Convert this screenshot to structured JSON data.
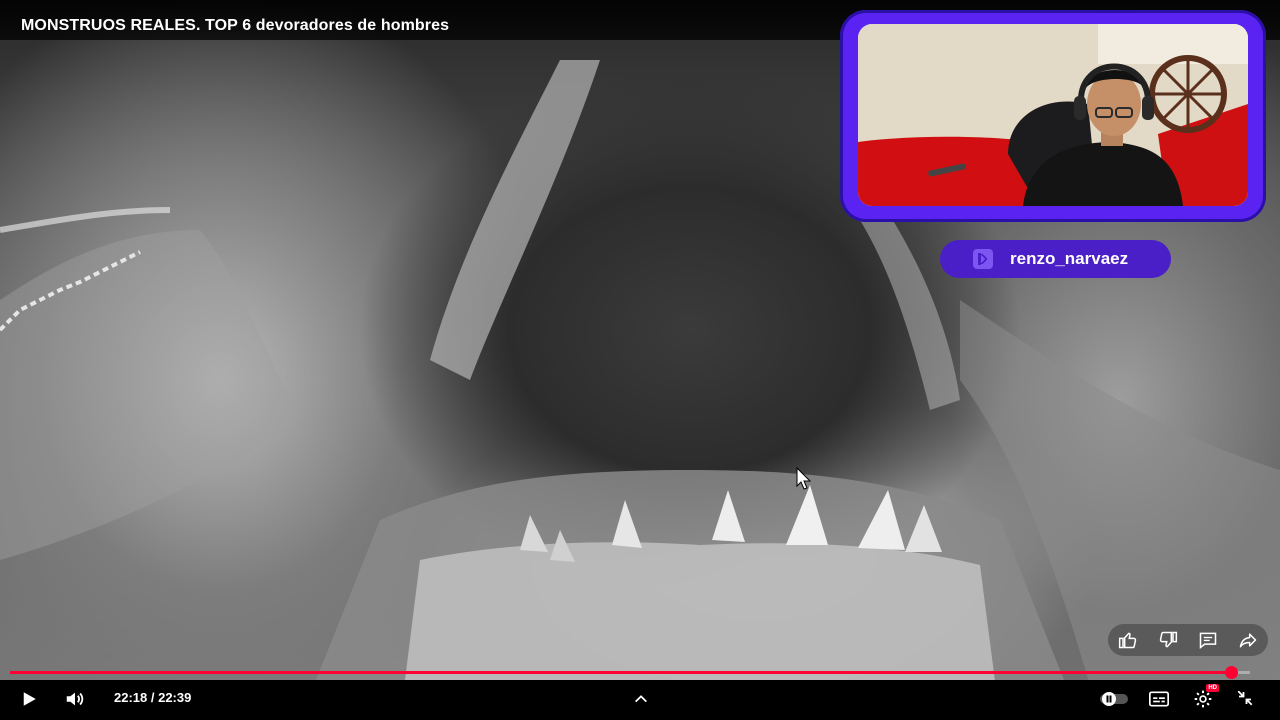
{
  "video": {
    "title": "MONSTRUOS REALES. TOP 6 devoradores de hombres",
    "current_time": "22:18",
    "separator": " / ",
    "duration": "22:39",
    "progress_fraction": 0.985
  },
  "overlay": {
    "streamer_name": "renzo_narvaez",
    "frame_color": "#5b23f2",
    "pill_color": "#4a1fc8"
  },
  "actions": {
    "like_icon": "thumbs-up-icon",
    "dislike_icon": "thumbs-down-icon",
    "comments_icon": "comment-icon",
    "share_icon": "share-icon"
  },
  "controls": {
    "play_icon": "play-icon",
    "volume_icon": "volume-icon",
    "expand_icon": "chevron-up-icon",
    "autoplay_icon": "autoplay-toggle-icon",
    "captions_icon": "captions-icon",
    "settings_icon": "gear-icon",
    "settings_badge": "HD",
    "exit_fullscreen_icon": "exit-fullscreen-icon"
  },
  "colors": {
    "accent": "#ff0033"
  }
}
